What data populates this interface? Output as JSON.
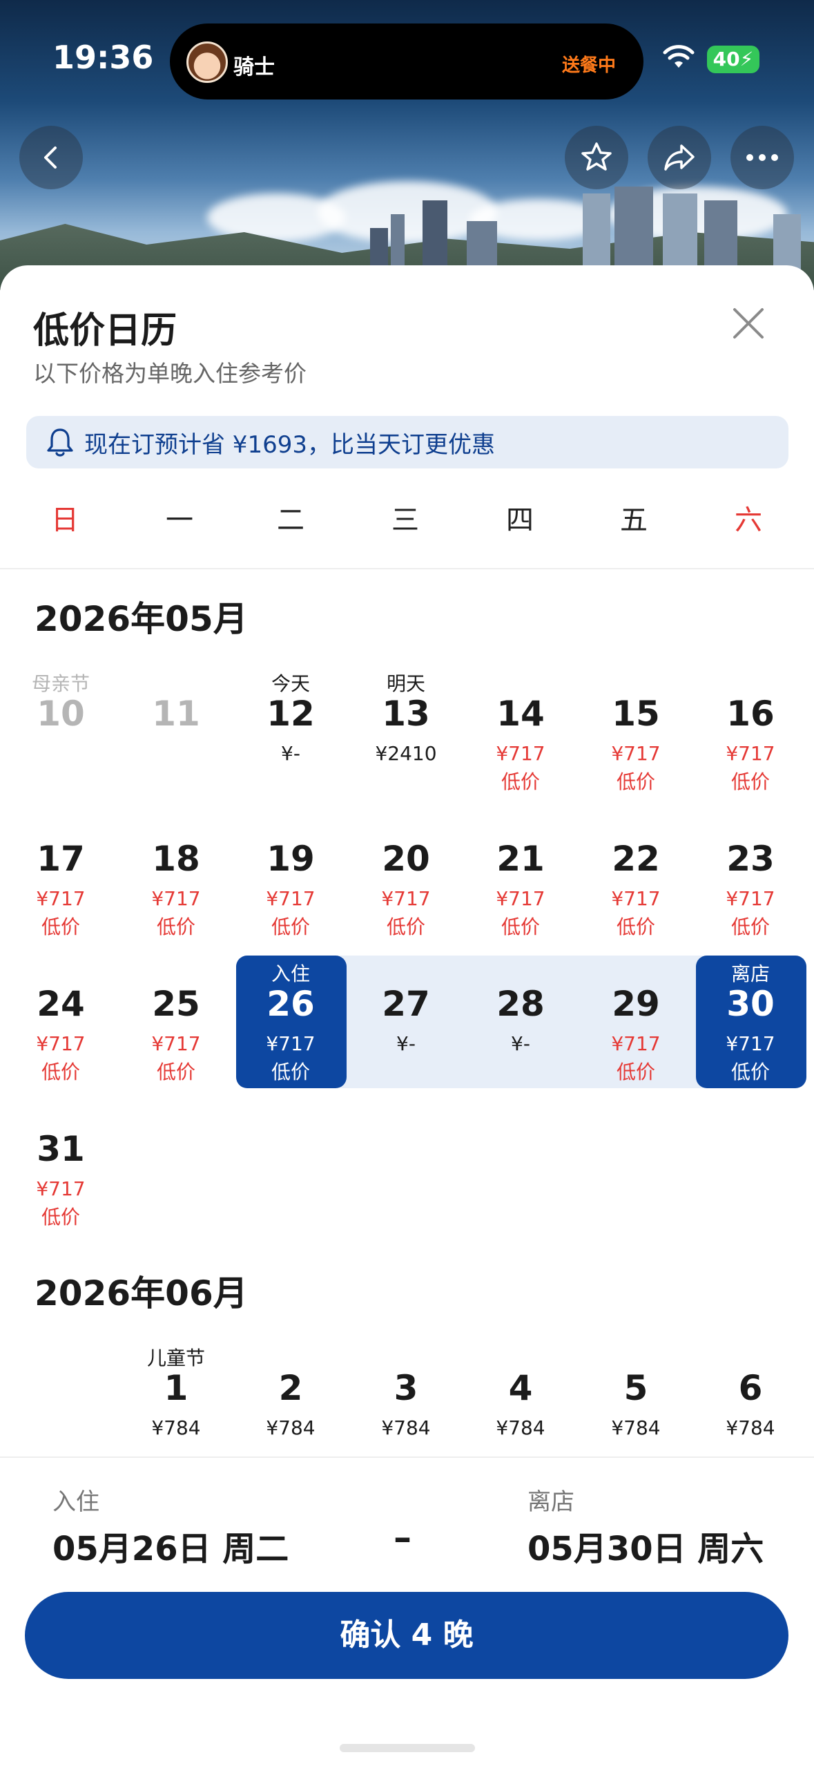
{
  "status_bar": {
    "time": "19:36",
    "rider_name": "骑士",
    "delivery_status": "送餐中",
    "battery": "40"
  },
  "header": {
    "title": "低价日历",
    "subtitle": "以下价格为单晚入住参考价"
  },
  "notice": {
    "text": "现在订预计省 ¥1693，比当天订更优惠"
  },
  "weekdays": [
    "日",
    "一",
    "二",
    "三",
    "四",
    "五",
    "六"
  ],
  "months": [
    {
      "title": "2026年05月",
      "days": [
        {
          "num": "10",
          "label": "母亲节",
          "price": "",
          "low": "",
          "state": "past"
        },
        {
          "num": "11",
          "label": "",
          "price": "",
          "low": "",
          "state": "past"
        },
        {
          "num": "12",
          "label": "今天",
          "price": "¥-",
          "low": "",
          "state": "normal"
        },
        {
          "num": "13",
          "label": "明天",
          "price": "¥2410",
          "low": "",
          "state": "normal"
        },
        {
          "num": "14",
          "label": "",
          "price": "¥717",
          "low": "低价",
          "state": "red"
        },
        {
          "num": "15",
          "label": "",
          "price": "¥717",
          "low": "低价",
          "state": "red"
        },
        {
          "num": "16",
          "label": "",
          "price": "¥717",
          "low": "低价",
          "state": "red"
        },
        {
          "num": "17",
          "label": "",
          "price": "¥717",
          "low": "低价",
          "state": "red"
        },
        {
          "num": "18",
          "label": "",
          "price": "¥717",
          "low": "低价",
          "state": "red"
        },
        {
          "num": "19",
          "label": "",
          "price": "¥717",
          "low": "低价",
          "state": "red"
        },
        {
          "num": "20",
          "label": "",
          "price": "¥717",
          "low": "低价",
          "state": "red"
        },
        {
          "num": "21",
          "label": "",
          "price": "¥717",
          "low": "低价",
          "state": "red"
        },
        {
          "num": "22",
          "label": "",
          "price": "¥717",
          "low": "低价",
          "state": "red"
        },
        {
          "num": "23",
          "label": "",
          "price": "¥717",
          "low": "低价",
          "state": "red"
        },
        {
          "num": "24",
          "label": "",
          "price": "¥717",
          "low": "低价",
          "state": "red"
        },
        {
          "num": "25",
          "label": "",
          "price": "¥717",
          "low": "低价",
          "state": "red"
        },
        {
          "num": "26",
          "label": "入住",
          "price": "¥717",
          "low": "低价",
          "state": "sel"
        },
        {
          "num": "27",
          "label": "",
          "price": "¥-",
          "low": "",
          "state": "range"
        },
        {
          "num": "28",
          "label": "",
          "price": "¥-",
          "low": "",
          "state": "range"
        },
        {
          "num": "29",
          "label": "",
          "price": "¥717",
          "low": "低价",
          "state": "red"
        },
        {
          "num": "30",
          "label": "离店",
          "price": "¥717",
          "low": "低价",
          "state": "sel"
        },
        {
          "num": "31",
          "label": "",
          "price": "¥717",
          "low": "低价",
          "state": "red"
        }
      ]
    },
    {
      "title": "2026年06月",
      "days": [
        {
          "num": "1",
          "label": "儿童节",
          "price": "¥784",
          "low": "",
          "state": "normal"
        },
        {
          "num": "2",
          "label": "",
          "price": "¥784",
          "low": "",
          "state": "normal"
        },
        {
          "num": "3",
          "label": "",
          "price": "¥784",
          "low": "",
          "state": "normal"
        },
        {
          "num": "4",
          "label": "",
          "price": "¥784",
          "low": "",
          "state": "normal"
        },
        {
          "num": "5",
          "label": "",
          "price": "¥784",
          "low": "",
          "state": "normal"
        },
        {
          "num": "6",
          "label": "",
          "price": "¥784",
          "low": "",
          "state": "normal"
        }
      ]
    }
  ],
  "summary": {
    "checkin_label": "入住",
    "checkin_value": "05月26日 周二",
    "dash": "–",
    "checkout_label": "离店",
    "checkout_value": "05月30日 周六"
  },
  "confirm_label": "确认 4 晚",
  "colors": {
    "primary": "#0d47a1",
    "low_price_red": "#e53935",
    "range_bg": "#e7eef8"
  }
}
